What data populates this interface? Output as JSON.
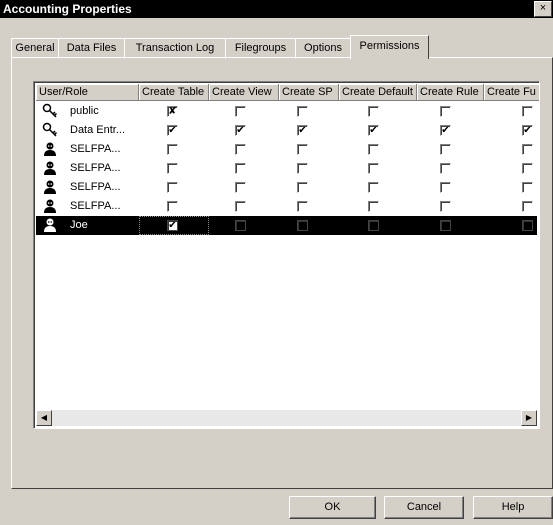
{
  "window": {
    "title": "Accounting Properties",
    "close_symbol": "×"
  },
  "tabs": [
    {
      "label": "General"
    },
    {
      "label": "Data Files"
    },
    {
      "label": "Transaction Log"
    },
    {
      "label": "Filegroups"
    },
    {
      "label": "Options"
    },
    {
      "label": "Permissions"
    }
  ],
  "active_tab": "Permissions",
  "grid": {
    "columns": [
      "User/Role",
      "Create Table",
      "Create View",
      "Create SP",
      "Create Default",
      "Create Rule",
      "Create Fu"
    ],
    "rows": [
      {
        "name": "public",
        "icon": "key-role-icon",
        "perms": [
          "denied",
          "off",
          "off",
          "off",
          "off",
          "off"
        ]
      },
      {
        "name": "Data Entr...",
        "icon": "key-role-icon",
        "perms": [
          "on",
          "on",
          "on",
          "on",
          "on",
          "on"
        ]
      },
      {
        "name": "SELFPA...",
        "icon": "user-icon",
        "perms": [
          "off",
          "off",
          "off",
          "off",
          "off",
          "off"
        ]
      },
      {
        "name": "SELFPA...",
        "icon": "user-icon",
        "perms": [
          "off",
          "off",
          "off",
          "off",
          "off",
          "off"
        ]
      },
      {
        "name": "SELFPA...",
        "icon": "user-icon",
        "perms": [
          "off",
          "off",
          "off",
          "off",
          "off",
          "off"
        ]
      },
      {
        "name": "SELFPA...",
        "icon": "user-icon",
        "perms": [
          "off",
          "off",
          "off",
          "off",
          "off",
          "off"
        ]
      },
      {
        "name": "Joe",
        "icon": "user-icon",
        "perms": [
          "on",
          "off",
          "off",
          "off",
          "off",
          "off"
        ],
        "selected": true
      }
    ]
  },
  "buttons": {
    "ok": "OK",
    "cancel": "Cancel",
    "help": "Help"
  },
  "symbols": {
    "check": "✔",
    "cross": "✘",
    "scroll_left": "◀",
    "scroll_right": "▶"
  }
}
